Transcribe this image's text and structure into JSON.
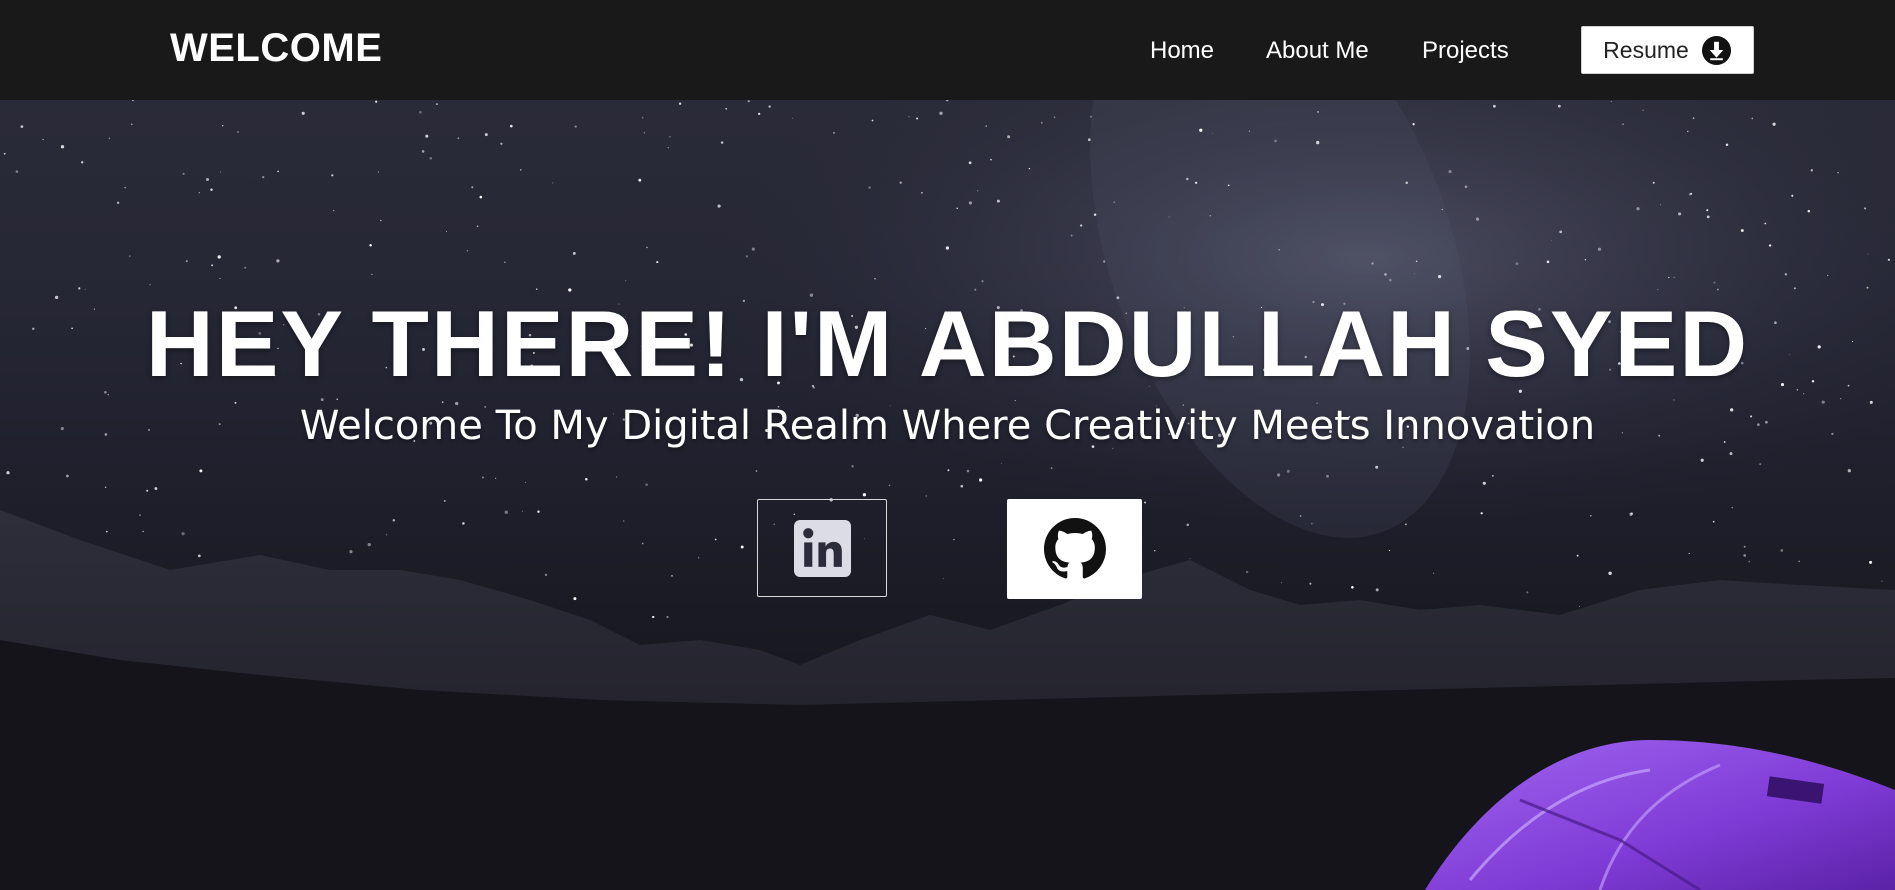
{
  "navbar": {
    "brand": "WELCOME",
    "links": [
      {
        "label": "Home"
      },
      {
        "label": "About Me"
      },
      {
        "label": "Projects"
      }
    ],
    "resume_button": {
      "label": "Resume",
      "icon": "download-circle-icon"
    }
  },
  "hero": {
    "title": "HEY THERE! I'M ABDULLAH SYED",
    "subtitle": "Welcome To My Digital Realm Where Creativity Meets Innovation",
    "social": [
      {
        "name": "LinkedIn",
        "icon": "linkedin-icon"
      },
      {
        "name": "GitHub",
        "icon": "github-icon"
      }
    ],
    "background": "night-sky-mountains-tent"
  },
  "colors": {
    "navbar_bg": "#1a1919",
    "text": "#ffffff",
    "button_bg": "#ffffff",
    "tent": "#8a3fd9"
  }
}
